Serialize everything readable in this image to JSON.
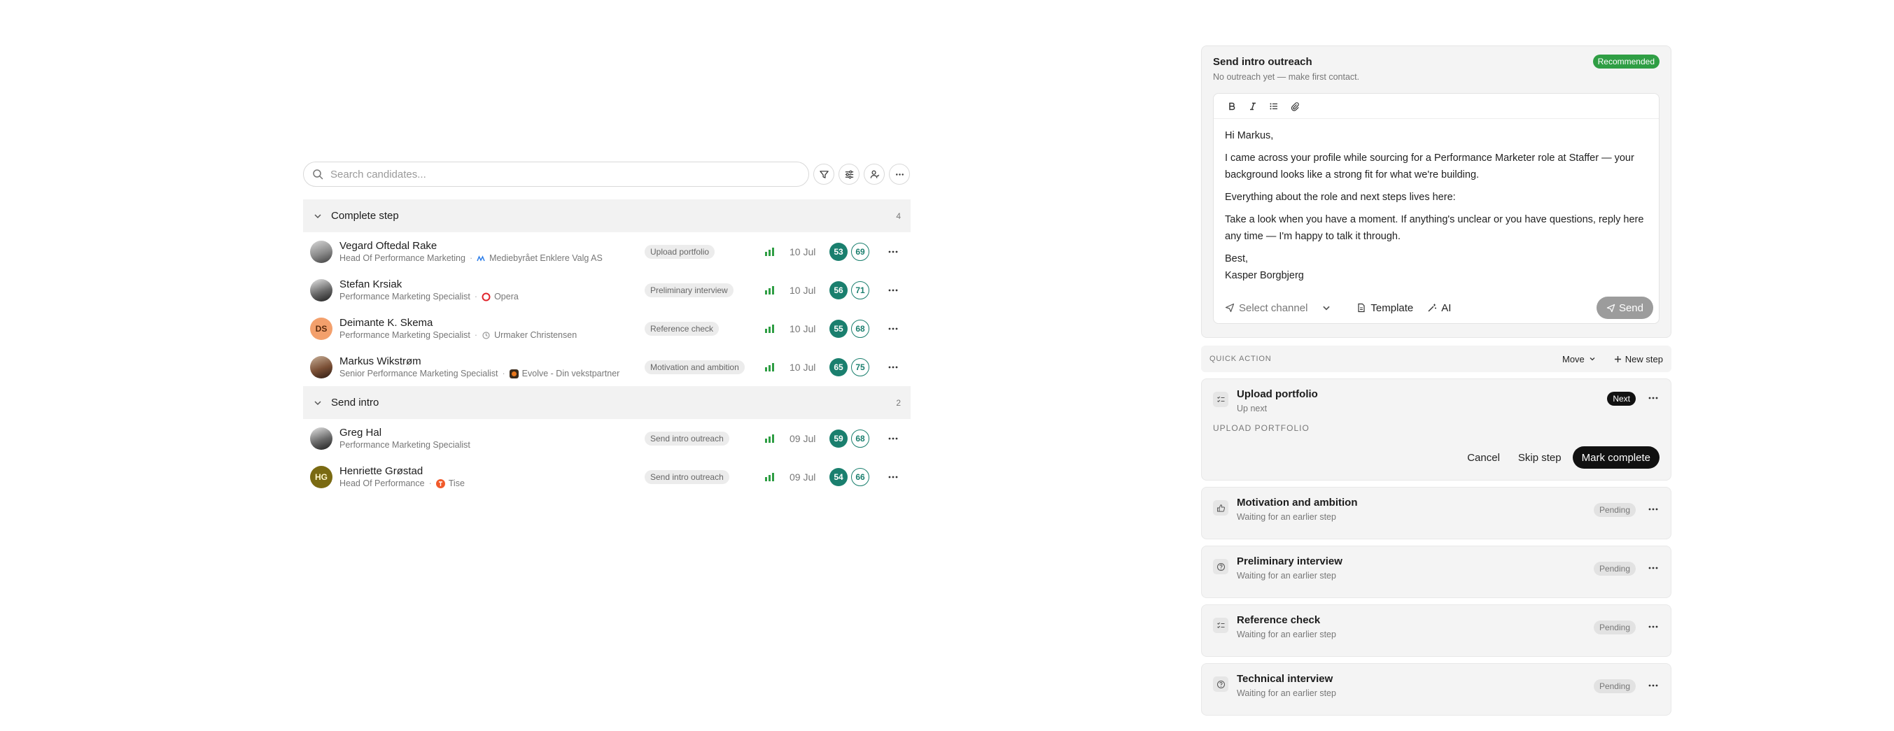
{
  "search": {
    "placeholder": "Search candidates..."
  },
  "toolbar_icons": [
    "filter-icon",
    "sliders-icon",
    "user-icon",
    "more-icon"
  ],
  "groups": [
    {
      "title": "Complete step",
      "count": "4",
      "candidates": [
        {
          "name": "Vegard Oftedal Rake",
          "title": "Head Of Performance Marketing",
          "company": "Mediebyrået Enklere Valg AS",
          "stage": "Upload portfolio",
          "date": "10 Jul",
          "score_a": "53",
          "score_b": "69"
        },
        {
          "name": "Stefan Krsiak",
          "title": "Performance Marketing Specialist",
          "company": "Opera",
          "stage": "Preliminary interview",
          "date": "10 Jul",
          "score_a": "56",
          "score_b": "71"
        },
        {
          "name": "Deimante K. Skema",
          "initials": "DS",
          "title": "Performance Marketing Specialist",
          "company": "Urmaker Christensen",
          "stage": "Reference check",
          "date": "10 Jul",
          "score_a": "55",
          "score_b": "68"
        },
        {
          "name": "Markus Wikstrøm",
          "title": "Senior Performance Marketing Specialist",
          "company": "Evolve - Din vekstpartner",
          "stage": "Motivation and ambition",
          "date": "10 Jul",
          "score_a": "65",
          "score_b": "75"
        }
      ]
    },
    {
      "title": "Send intro",
      "count": "2",
      "candidates": [
        {
          "name": "Greg Hal",
          "title": "Performance Marketing Specialist",
          "company": "",
          "stage": "Send intro outreach",
          "date": "09 Jul",
          "score_a": "59",
          "score_b": "68"
        },
        {
          "name": "Henriette Grøstad",
          "initials": "HG",
          "title": "Head Of Performance",
          "company": "Tise",
          "stage": "Send intro outreach",
          "date": "09 Jul",
          "score_a": "54",
          "score_b": "66"
        }
      ]
    }
  ],
  "outreach": {
    "title": "Send intro outreach",
    "badge": "Recommended",
    "subtitle": "No outreach yet — make first contact.",
    "message": {
      "greeting": "Hi Markus,",
      "p1": "I came across your profile while sourcing for a Performance Marketer role at Staffer — your background looks like a strong fit for what we're building.",
      "p2": "Everything about the role and next steps lives here:",
      "p3": "Take a look when you have a moment. If anything's unclear or you have questions, reply here any time — I'm happy to talk it through.",
      "signoff": "Best,",
      "signature": "Kasper Borgbjerg"
    },
    "channel_placeholder": "Select channel",
    "template_label": "Template",
    "ai_label": "AI",
    "send_label": "Send"
  },
  "quick_action": {
    "label": "QUICK ACTION",
    "move_label": "Move",
    "new_step_label": "New step"
  },
  "active_step": {
    "title": "Upload portfolio",
    "subtitle": "Up next",
    "badge": "Next",
    "section_label": "UPLOAD PORTFOLIO",
    "cancel_label": "Cancel",
    "skip_label": "Skip step",
    "complete_label": "Mark complete"
  },
  "pending_steps": [
    {
      "title": "Motivation and ambition",
      "subtitle": "Waiting for an earlier step",
      "badge": "Pending",
      "icon": "thumbs-up-icon"
    },
    {
      "title": "Preliminary interview",
      "subtitle": "Waiting for an earlier step",
      "badge": "Pending",
      "icon": "question-icon"
    },
    {
      "title": "Reference check",
      "subtitle": "Waiting for an earlier step",
      "badge": "Pending",
      "icon": "checklist-icon"
    },
    {
      "title": "Technical interview",
      "subtitle": "Waiting for an earlier step",
      "badge": "Pending",
      "icon": "question-icon"
    }
  ],
  "colors": {
    "accent_teal": "#1a7f6e",
    "recommended_green": "#2f9e44",
    "signal_green": "#2f9e44",
    "panel_bg": "#f4f4f4"
  }
}
